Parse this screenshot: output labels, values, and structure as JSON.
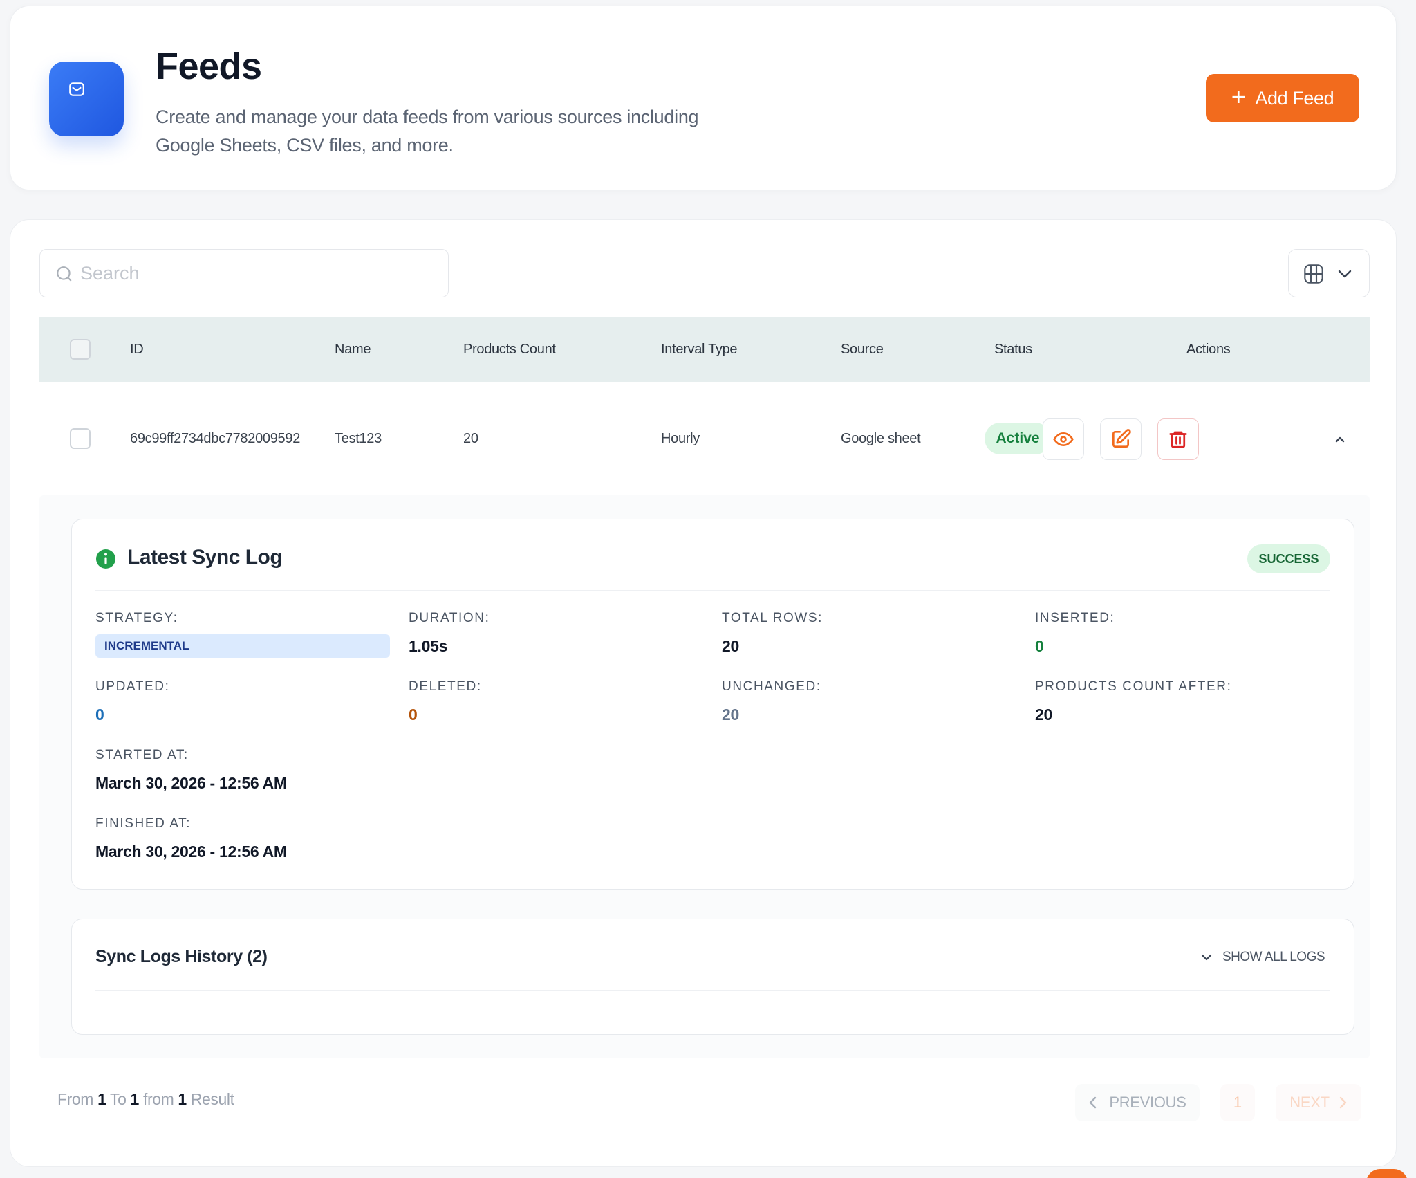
{
  "header": {
    "title": "Feeds",
    "description": "Create and manage your data feeds from various sources including Google Sheets, CSV files, and more.",
    "add_button_label": "Add Feed",
    "add_button_icon": "plus-icon",
    "logo_icon": "mail-icon"
  },
  "search": {
    "placeholder": "Search",
    "value": ""
  },
  "table": {
    "columns": [
      "ID",
      "Name",
      "Products Count",
      "Interval Type",
      "Source",
      "Status",
      "Actions"
    ],
    "rows": [
      {
        "id": "69c99ff2734dbc7782009592",
        "name": "Test123",
        "products_count": "20",
        "interval_type": "Hourly",
        "source": "Google sheet",
        "status": "Active"
      }
    ]
  },
  "sync_log": {
    "title": "Latest Sync Log",
    "status": "SUCCESS",
    "fields": {
      "strategy_label": "STRATEGY:",
      "strategy": "INCREMENTAL",
      "duration_label": "DURATION:",
      "duration": "1.05s",
      "total_rows_label": "TOTAL ROWS:",
      "total_rows": "20",
      "inserted_label": "INSERTED:",
      "inserted": "0",
      "updated_label": "UPDATED:",
      "updated": "0",
      "deleted_label": "DELETED:",
      "deleted": "0",
      "unchanged_label": "UNCHANGED:",
      "unchanged": "20",
      "products_count_after_label": "PRODUCTS COUNT AFTER:",
      "products_count_after": "20",
      "started_at_label": "STARTED AT:",
      "started_at": "March 30, 2026 - 12:56 AM",
      "finished_at_label": "FINISHED AT:",
      "finished_at": "March 30, 2026 - 12:56 AM"
    }
  },
  "history": {
    "title": "Sync Logs History (2)",
    "show_all_label": "SHOW ALL LOGS"
  },
  "pagination": {
    "from_word": "From",
    "from": "1",
    "to_word": "To",
    "to": "1",
    "of_word": "from",
    "total": "1",
    "result_word": "Result",
    "previous_label": "PREVIOUS",
    "current_page": "1",
    "next_label": "NEXT"
  },
  "colors": {
    "accent": "#f26b1d",
    "brand_blue": "#2563eb",
    "success_bg": "#dcf6e4",
    "success_text": "#15803d",
    "inserted": "#15803d",
    "updated": "#1d6fb8",
    "deleted": "#b45309",
    "unchanged": "#64748b",
    "danger": "#dc2626"
  }
}
